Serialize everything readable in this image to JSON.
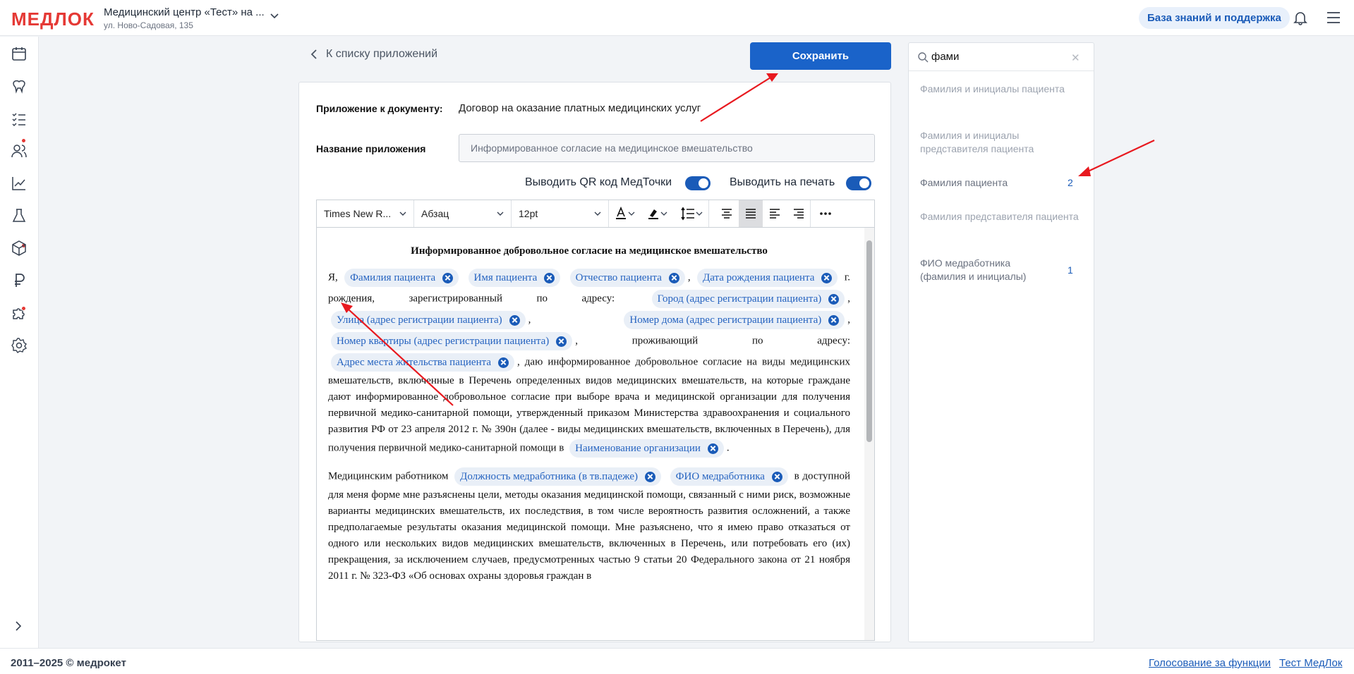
{
  "header": {
    "logo": "МЕДЛОК",
    "clinic_name": "Медицинский центр «Тест» на ...",
    "clinic_address": "ул. Ново-Садовая, 135",
    "kb_button": "База знаний и поддержка"
  },
  "nav": {
    "back_label": "К списку приложений",
    "save_label": "Сохранить"
  },
  "form": {
    "doc_label": "Приложение к документу:",
    "doc_value": "Договор на оказание платных медицинских услуг",
    "name_label": "Название приложения",
    "name_value": "Информированное согласие на медицинское вмешательство",
    "toggle_qr_label": "Выводить QR код МедТочки",
    "toggle_print_label": "Выводить на печать"
  },
  "toolbar": {
    "font": "Times New R...",
    "block": "Абзац",
    "size": "12pt"
  },
  "document": {
    "title": "Информированное добровольное согласие на медицинское вмешательство",
    "t_ya": "Я,",
    "t_g": "г. рождения, зарегистрированный по адресу:",
    "t_prozh": "проживающий по адресу:",
    "t_body1": ", даю информированное добровольное согласие на виды медицинских вмешательств, включенные в Перечень определенных видов медицинских вмешательств, на которые граждане дают информированное добровольное согласие при выборе врача и медицинской организации для получения первичной медико-санитарной помощи, утвержденный приказом Министерства здравоохранения и социального развития РФ от 23 апреля 2012 г. № 390н (далее - виды медицинских вмешательств, включенных в Перечень), для получения первичной медико-санитарной помощи в",
    "t_dot": ".",
    "t_medrab": "Медицинским работником",
    "t_body2": "в доступной для меня форме мне разъяснены цели, методы оказания медицинской помощи, связанный с ними риск, возможные варианты медицинских вмешательств, их последствия, в том числе вероятность развития осложнений, а также предполагаемые результаты оказания медицинской помощи. Мне разъяснено, что я имею право отказаться от одного или нескольких видов медицинских вмешательств, включенных в Перечень, или потребовать его (их) прекращения, за исключением случаев, предусмотренных частью 9 статьи 20 Федерального закона от 21 ноября 2011 г. № 323-ФЗ «Об основах охраны здоровья граждан в",
    "chips": {
      "surname": "Фамилия пациента",
      "name": "Имя пациента",
      "patronymic": "Отчество пациента",
      "birth": "Дата рождения пациента",
      "city": "Город (адрес регистрации пациента)",
      "street": "Улица (адрес регистрации пациента)",
      "house": "Номер дома (адрес регистрации пациента)",
      "flat": "Номер квартиры (адрес регистрации пациента)",
      "residence": "Адрес места жительства пациента",
      "org": "Наименование организации",
      "position": "Должность медработника (в тв.падеже)",
      "fio": "ФИО медработника"
    }
  },
  "variables_panel": {
    "search_value": "фами",
    "items": [
      {
        "label": "Фамилия и инициалы пациента",
        "count": ""
      },
      {
        "label": "Фамилия и инициалы представителя пациента",
        "count": ""
      },
      {
        "label": "Фамилия пациента",
        "count": "2"
      },
      {
        "label": "Фамилия представителя пациента",
        "count": ""
      },
      {
        "label": "ФИО медработника (фамилия и инициалы)",
        "count": "1"
      }
    ]
  },
  "footer": {
    "copyright": "2011–2025 © медрокет",
    "link1": "Голосование за функции",
    "link2": "Тест МедЛок"
  },
  "colors": {
    "accent": "#1a63c9",
    "brand_red": "#e53935",
    "annotation": "#e8191f"
  }
}
